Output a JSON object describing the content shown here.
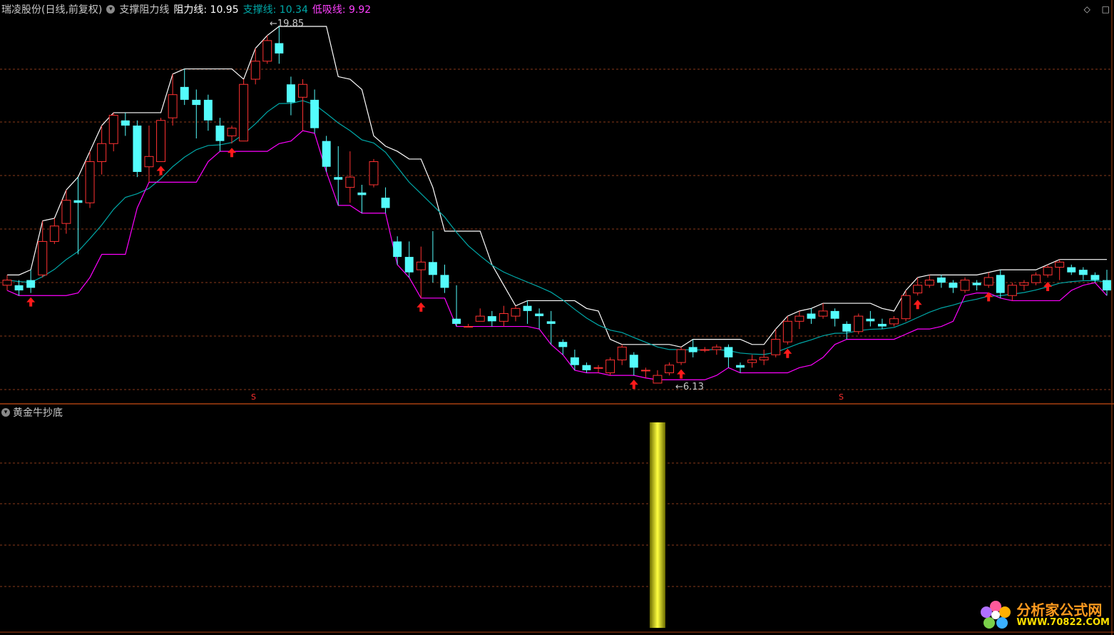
{
  "header": {
    "stock": "瑞凌股份(日线,前复权)",
    "indicator": "支撑阻力线",
    "resist_label": "阻力线: 10.95",
    "support_label": "支撑线: 10.34",
    "low_label": "低吸线: 9.92"
  },
  "sub_panel": {
    "title": "黄金牛抄底"
  },
  "annotations": {
    "high": "19.85",
    "low": "6.13",
    "s_marks": [
      "S",
      "S"
    ]
  },
  "top_right_icons": [
    "diamond-icon",
    "fullscreen-icon"
  ],
  "watermark": {
    "name": "分析家公式网",
    "url": "WWW.70822.COM"
  },
  "colors": {
    "background": "#000000",
    "up": "#ff3232",
    "down": "#54fcfc",
    "resist": "#ffffff",
    "support": "#00a8a8",
    "low": "#ff00ff",
    "grid": "#8a3a1a",
    "signal": "#ffff00"
  },
  "chart_data": {
    "type": "candlestick",
    "price_range": [
      6.13,
      19.85
    ],
    "candles": [
      [
        9.8,
        10.2,
        10.0,
        9.6
      ],
      [
        9.8,
        10.0,
        9.6,
        9.4
      ],
      [
        10.0,
        10.4,
        9.7,
        9.5
      ],
      [
        10.2,
        12.3,
        11.5,
        10.1
      ],
      [
        11.5,
        12.4,
        12.1,
        11.4
      ],
      [
        12.2,
        13.5,
        13.1,
        11.8
      ],
      [
        13.1,
        14.0,
        13.0,
        11.0
      ],
      [
        13.0,
        15.0,
        14.6,
        12.8
      ],
      [
        14.6,
        16.0,
        15.3,
        14.1
      ],
      [
        15.3,
        16.5,
        16.4,
        15.0
      ],
      [
        16.2,
        16.5,
        16.0,
        15.6
      ],
      [
        16.0,
        16.2,
        14.2,
        14.0
      ],
      [
        14.4,
        16.0,
        14.8,
        13.8
      ],
      [
        14.6,
        16.3,
        16.2,
        14.6
      ],
      [
        16.3,
        18.0,
        17.2,
        16.0
      ],
      [
        17.5,
        18.2,
        17.0,
        16.8
      ],
      [
        17.0,
        17.4,
        16.8,
        15.5
      ],
      [
        17.0,
        17.2,
        16.2,
        15.8
      ],
      [
        16.0,
        16.3,
        15.4,
        15.0
      ],
      [
        15.6,
        16.0,
        15.9,
        15.3
      ],
      [
        15.4,
        17.8,
        17.6,
        15.4
      ],
      [
        17.8,
        19.0,
        18.5,
        17.6
      ],
      [
        18.5,
        19.5,
        19.3,
        18.4
      ],
      [
        19.2,
        19.85,
        18.8,
        18.4
      ],
      [
        17.6,
        17.9,
        16.9,
        16.4
      ],
      [
        17.1,
        17.8,
        17.6,
        15.8
      ],
      [
        17.0,
        17.4,
        15.9,
        15.7
      ],
      [
        15.4,
        15.6,
        14.4,
        14.2
      ],
      [
        14.0,
        15.2,
        13.9,
        12.9
      ],
      [
        13.6,
        15.0,
        14.0,
        13.0
      ],
      [
        13.4,
        13.7,
        13.3,
        12.6
      ],
      [
        13.7,
        14.7,
        14.6,
        13.6
      ],
      [
        13.2,
        13.6,
        12.8,
        12.6
      ],
      [
        11.5,
        11.7,
        10.9,
        10.6
      ],
      [
        10.9,
        11.5,
        10.3,
        10.1
      ],
      [
        10.4,
        11.3,
        10.7,
        9.3
      ],
      [
        10.7,
        11.9,
        10.2,
        9.9
      ],
      [
        10.2,
        10.6,
        9.7,
        9.5
      ],
      [
        8.5,
        9.8,
        8.3,
        8.2
      ],
      [
        8.2,
        8.3,
        8.2,
        8.2
      ],
      [
        8.4,
        8.9,
        8.6,
        8.4
      ],
      [
        8.6,
        8.8,
        8.4,
        8.2
      ],
      [
        8.4,
        9.0,
        8.7,
        8.2
      ],
      [
        8.6,
        9.0,
        8.9,
        8.4
      ],
      [
        9.0,
        9.2,
        8.8,
        8.3
      ],
      [
        8.7,
        8.9,
        8.6,
        8.1
      ],
      [
        8.4,
        8.8,
        8.3,
        7.5
      ],
      [
        7.6,
        7.7,
        7.4,
        7.1
      ],
      [
        7.0,
        7.3,
        6.7,
        6.5
      ],
      [
        6.7,
        6.8,
        6.5,
        6.4
      ],
      [
        6.6,
        6.7,
        6.6,
        6.4
      ],
      [
        6.4,
        7.0,
        6.9,
        6.3
      ],
      [
        6.9,
        7.5,
        7.4,
        6.7
      ],
      [
        7.1,
        7.2,
        6.6,
        6.3
      ],
      [
        6.5,
        6.6,
        6.5,
        6.2
      ],
      [
        6.0,
        6.5,
        6.3,
        6.13
      ],
      [
        6.4,
        6.8,
        6.7,
        6.3
      ],
      [
        6.8,
        7.4,
        7.3,
        6.7
      ],
      [
        7.4,
        7.7,
        7.2,
        7.0
      ],
      [
        7.3,
        7.4,
        7.3,
        7.2
      ],
      [
        7.3,
        7.5,
        7.4,
        7.1
      ],
      [
        7.4,
        7.5,
        7.0,
        6.6
      ],
      [
        6.7,
        6.8,
        6.6,
        6.4
      ],
      [
        6.8,
        7.1,
        6.9,
        6.6
      ],
      [
        6.9,
        7.3,
        7.0,
        6.7
      ],
      [
        7.1,
        8.1,
        7.7,
        7.0
      ],
      [
        7.6,
        8.6,
        8.4,
        7.5
      ],
      [
        8.4,
        8.8,
        8.6,
        8.1
      ],
      [
        8.7,
        8.9,
        8.5,
        8.3
      ],
      [
        8.6,
        9.1,
        8.8,
        8.5
      ],
      [
        8.8,
        8.9,
        8.5,
        8.2
      ],
      [
        8.3,
        8.4,
        8.0,
        7.7
      ],
      [
        8.0,
        8.7,
        8.6,
        7.9
      ],
      [
        8.5,
        8.8,
        8.4,
        8.2
      ],
      [
        8.3,
        8.5,
        8.2,
        8.1
      ],
      [
        8.3,
        8.6,
        8.5,
        8.2
      ],
      [
        8.5,
        9.6,
        9.4,
        8.4
      ],
      [
        9.5,
        10.1,
        9.8,
        9.4
      ],
      [
        9.8,
        10.2,
        10.0,
        9.7
      ],
      [
        10.1,
        10.2,
        9.9,
        9.7
      ],
      [
        9.9,
        10.0,
        9.7,
        9.5
      ],
      [
        9.6,
        10.1,
        10.0,
        9.5
      ],
      [
        9.9,
        10.0,
        9.8,
        9.6
      ],
      [
        9.8,
        10.3,
        10.1,
        9.7
      ],
      [
        10.2,
        10.4,
        9.5,
        9.3
      ],
      [
        9.4,
        9.9,
        9.8,
        9.2
      ],
      [
        9.8,
        10.0,
        9.9,
        9.6
      ],
      [
        9.9,
        10.3,
        10.2,
        9.8
      ],
      [
        10.2,
        10.6,
        10.5,
        10.1
      ],
      [
        10.5,
        10.8,
        10.7,
        10.0
      ],
      [
        10.5,
        10.6,
        10.3,
        10.2
      ],
      [
        10.4,
        10.5,
        10.2,
        10.0
      ],
      [
        10.2,
        10.3,
        10.0,
        9.9
      ],
      [
        10.0,
        10.4,
        9.6,
        9.4
      ]
    ],
    "signals_up_arrow_index": [
      2,
      13,
      19,
      35,
      53,
      57,
      66,
      77,
      83,
      88
    ],
    "golden_bull_signal_index": 55
  }
}
